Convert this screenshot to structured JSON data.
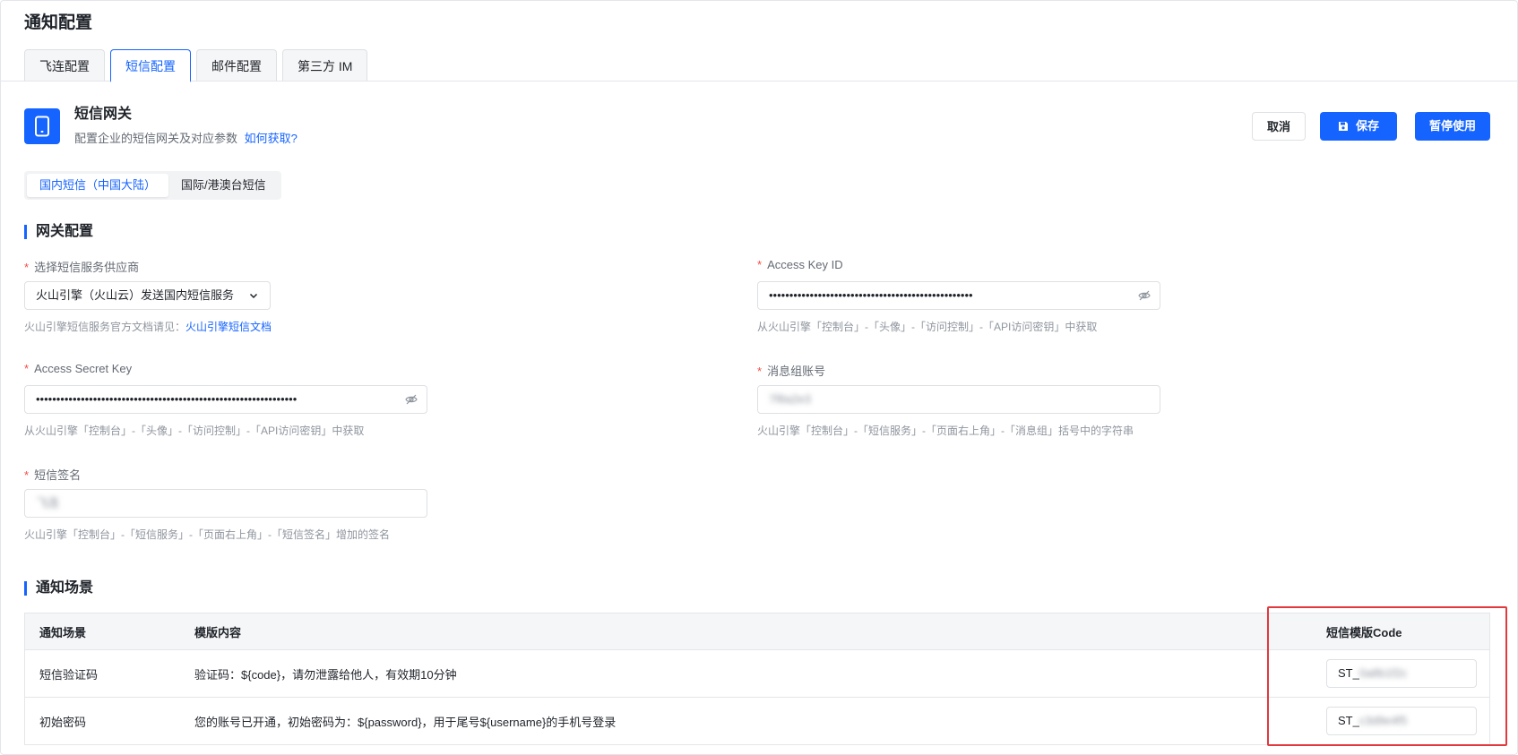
{
  "page": {
    "title": "通知配置"
  },
  "tabs": [
    {
      "label": "飞连配置",
      "active": false
    },
    {
      "label": "短信配置",
      "active": true
    },
    {
      "label": "邮件配置",
      "active": false
    },
    {
      "label": "第三方 IM",
      "active": false
    }
  ],
  "gateway": {
    "title": "短信网关",
    "description": "配置企业的短信网关及对应参数",
    "help_link": "如何获取?",
    "icon": "phone-icon"
  },
  "actions": {
    "cancel": "取消",
    "save": "保存",
    "pause": "暂停使用"
  },
  "region_tabs": [
    {
      "label": "国内短信（中国大陆）",
      "active": true
    },
    {
      "label": "国际/港澳台短信",
      "active": false
    }
  ],
  "gateway_config": {
    "section_title": "网关配置",
    "provider": {
      "label": "选择短信服务供应商",
      "value": "火山引擎（火山云）发送国内短信服务",
      "hint": "火山引擎短信服务官方文档请见：",
      "hint_link": "火山引擎短信文档"
    },
    "access_key_id": {
      "label": "Access Key ID",
      "value": "••••••••••••••••••••••••••••••••••••••••••••••••••",
      "hint": "从火山引擎「控制台」-「头像」-「访问控制」-「API访问密钥」中获取"
    },
    "access_secret_key": {
      "label": "Access Secret Key",
      "value": "••••••••••••••••••••••••••••••••••••••••••••••••••••••••••••••••",
      "hint": "从火山引擎「控制台」-「头像」-「访问控制」-「API访问密钥」中获取"
    },
    "message_group": {
      "label": "消息组账号",
      "value": "7f8a2e3",
      "hint": "火山引擎「控制台」-「短信服务」-「页面右上角」-「消息组」括号中的字符串"
    },
    "sms_signature": {
      "label": "短信签名",
      "value": "飞连",
      "hint": "火山引擎「控制台」-「短信服务」-「页面右上角」-「短信签名」增加的签名"
    }
  },
  "scenes": {
    "section_title": "通知场景",
    "columns": [
      "通知场景",
      "模版内容",
      "短信模版Code"
    ],
    "rows": [
      {
        "scene": "短信验证码",
        "template": "验证码：${code}，请勿泄露给他人，有效期10分钟",
        "code_prefix": "ST_",
        "code_hidden": "0a8b1f2c"
      },
      {
        "scene": "初始密码",
        "template": "您的账号已开通，初始密码为：${password}，用于尾号${username}的手机号登录",
        "code_prefix": "ST_",
        "code_hidden": "c3d9e4f5"
      }
    ]
  },
  "colors": {
    "primary": "#1664ff",
    "required": "#f54a45",
    "highlight": "#e0393e"
  }
}
